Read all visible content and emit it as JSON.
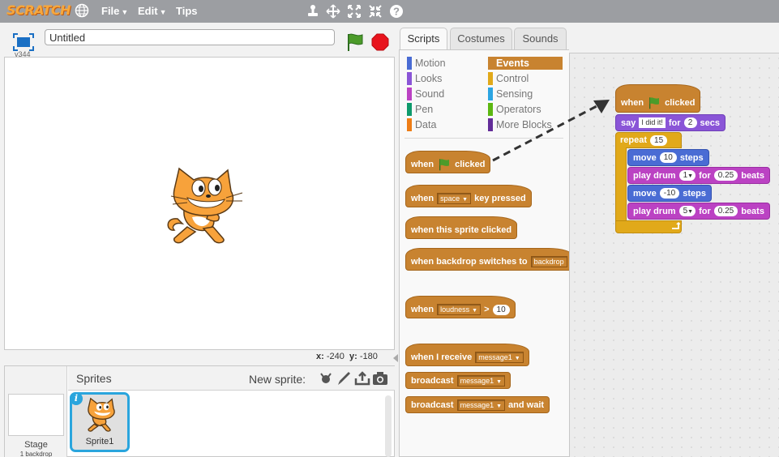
{
  "menubar": {
    "logo": "SCRATCH",
    "file": "File",
    "edit": "Edit",
    "tips": "Tips",
    "tools": [
      "duplicate-stamp-icon",
      "cut-scissors-icon",
      "grow-icon",
      "shrink-icon",
      "help-icon"
    ]
  },
  "stage_header": {
    "version": "v344",
    "project_title": "Untitled"
  },
  "coords": {
    "x_label": "x:",
    "x_value": "-240",
    "y_label": "y:",
    "y_value": "-180"
  },
  "sprite_pane": {
    "title": "Sprites",
    "new_sprite": "New sprite:",
    "stage_label": "Stage",
    "stage_sub": "1 backdrop",
    "sprite1_label": "Sprite1",
    "info": "i"
  },
  "tabs": {
    "scripts": "Scripts",
    "costumes": "Costumes",
    "sounds": "Sounds"
  },
  "categories": {
    "motion": "Motion",
    "looks": "Looks",
    "sound": "Sound",
    "pen": "Pen",
    "data": "Data",
    "events": "Events",
    "control": "Control",
    "sensing": "Sensing",
    "operators": "Operators",
    "more": "More Blocks"
  },
  "colors": {
    "motion": "#4a6cd4",
    "looks": "#8a55d7",
    "sound": "#bb42c3",
    "pen": "#0e9a6c",
    "data": "#ee7d16",
    "events": "#c88330",
    "control": "#e1a91a",
    "sensing": "#2ca5e2",
    "operators": "#5cb712",
    "more": "#632d99"
  },
  "palette": {
    "flag_when": "when",
    "flag_clicked": "clicked",
    "key_when": "when",
    "key_value": "space",
    "key_pressed": "key pressed",
    "sprite_clicked": "when this sprite clicked",
    "backdrop_when": "when backdrop switches to",
    "backdrop_value": "backdrop",
    "loud_when": "when",
    "loud_value": "loudness",
    "loud_op": ">",
    "loud_num": "10",
    "receive_when": "when I receive",
    "receive_value": "message1",
    "broadcast": "broadcast",
    "broadcast_value": "message1",
    "broadcast_wait": "broadcast",
    "broadcast_wait_value": "message1",
    "broadcast_wait_tail": "and wait"
  },
  "script": {
    "hat_when": "when",
    "hat_clicked": "clicked",
    "say": "say",
    "say_text": "I did it!",
    "say_for": "for",
    "say_secs_value": "2",
    "say_secs": "secs",
    "repeat": "repeat",
    "repeat_value": "15",
    "move1": "move",
    "move1_value": "10",
    "move1_steps": "steps",
    "drum1": "play drum",
    "drum1_value": "1",
    "drum1_for": "for",
    "drum1_beats_value": "0.25",
    "drum1_beats": "beats",
    "move2": "move",
    "move2_value": "-10",
    "move2_steps": "steps",
    "drum2": "play drum",
    "drum2_value": "5",
    "drum2_for": "for",
    "drum2_beats_value": "0.25",
    "drum2_beats": "beats"
  }
}
